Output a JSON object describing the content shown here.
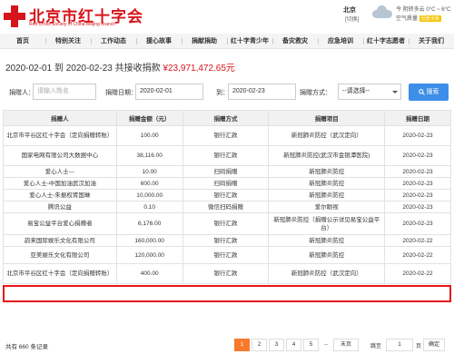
{
  "header": {
    "logo_cn": "北京市红十字会",
    "logo_en": "Red Cross Society of China Beijing Branch",
    "city": "北京",
    "city_switch": "[切换]",
    "weather": "今 阴转多云 0°C ~ 6°C",
    "air_quality_label": "空气质量",
    "air_quality_value": "轻度污染"
  },
  "nav": [
    "首页",
    "特别关注",
    "工作动态",
    "援心故事",
    "捐献捐助",
    "红十字青少年",
    "备灾救灾",
    "应急培训",
    "红十字志愿者",
    "关于我们"
  ],
  "summary": {
    "prefix": "2020-02-01 到 2020-02-23 共接收捐款",
    "amount": "¥23,971,472.65元"
  },
  "filters": {
    "donor_label": "捐赠人：",
    "donor_placeholder": "请输入姓名",
    "date_label": "捐赠日期：",
    "date_from": "2020-02-01",
    "to_label": "到：",
    "date_to": "2020-02-23",
    "method_label": "捐赠方式：",
    "method_selected": "--请选择--",
    "search_label": "搜索"
  },
  "table": {
    "headers": [
      "捐赠人",
      "捐赠金额（元）",
      "捐赠方式",
      "捐赠项目",
      "捐赠日期"
    ],
    "rows": [
      [
        "北京市平谷区红十字会（定向捐赠转账）",
        "100.00",
        "银行汇款",
        "新冠肺炎防控（武汉定向）",
        "2020-02-23"
      ],
      [
        "国家电网有限公司大数据中心",
        "38,116.00",
        "银行汇款",
        "新冠肺炎防控(武汉市金银潭医院)",
        "2020-02-23"
      ],
      [
        "爱心人士---",
        "10.00",
        "扫码捐赠",
        "新冠肺炎防控",
        "2020-02-23"
      ],
      [
        "爱心人士-中国加油武汉加油",
        "600.00",
        "扫码捐赠",
        "新冠肺炎防控",
        "2020-02-23"
      ],
      [
        "爱心人士-朱振权胥国琳",
        "10,000.00",
        "银行汇款",
        "新冠肺炎防控",
        "2020-02-23"
      ],
      [
        "腾讯公益",
        "0.10",
        "微信扫码捐赠",
        "爱尔眼视",
        "2020-02-23"
      ],
      [
        "易宝公益平台爱心捐赠者",
        "6,176.00",
        "银行汇款",
        "新冠肺炎防控（捐赠公示详见易宝公益平台）",
        "2020-02-23"
      ],
      [
        "韵来国际娱乐文化有限公司",
        "160,000.00",
        "银行汇款",
        "新冠肺炎防控",
        "2020-02-22"
      ],
      [
        "亚美娱乐文化有限公司",
        "120,000.00",
        "银行汇款",
        "新冠肺炎防控",
        "2020-02-22"
      ],
      [
        "北京市平谷区红十字会（定向捐赠转账）",
        "400.00",
        "银行汇款",
        "新冠肺炎防控（武汉定向）",
        "2020-02-22"
      ]
    ]
  },
  "pagination": {
    "total": "共有 660 条记录",
    "pages": [
      "1",
      "2",
      "3",
      "4",
      "5",
      "...",
      "末页"
    ],
    "active": "1",
    "jump_label": "跳至",
    "jump_value": "1",
    "page_suffix": "页",
    "confirm": "确定"
  }
}
